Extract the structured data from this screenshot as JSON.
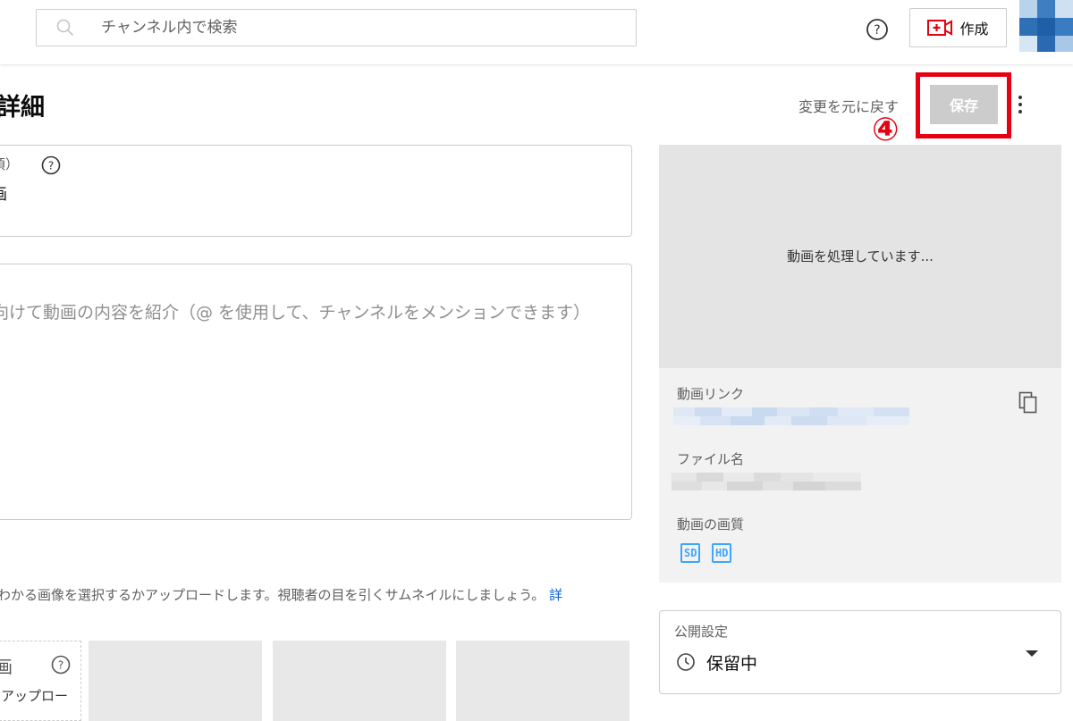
{
  "topbar": {
    "search": {
      "placeholder": "チャンネル内で検索",
      "value": ""
    },
    "create_label": "作成",
    "icons": {
      "search": "search-icon",
      "help": "help-icon",
      "create": "video-add-icon",
      "avatar": "pixel-avatar"
    }
  },
  "header": {
    "title": "詳細",
    "undo_label": "変更を元に戻す",
    "save_label": "保存",
    "annotation_number": "④",
    "more_icon": "more-vertical-icon"
  },
  "title_field": {
    "label": "須）",
    "value": "画"
  },
  "description_field": {
    "placeholder": "向けて動画の内容を紹介（@ を使用して、チャンネルをメンションできます）"
  },
  "thumbnail": {
    "description": "わかる画像を選択するかアップロードします。視聴者の目を引くサムネイルにしましょう。",
    "more_link": "詳",
    "upload_icon_glyph": "画",
    "upload_label": "アップロー"
  },
  "video_panel": {
    "processing_text": "動画を処理しています...",
    "link_label": "動画リンク",
    "filename_label": "ファイル名",
    "quality_label": "動画の画質",
    "quality_badges": [
      "SD",
      "HD"
    ]
  },
  "visibility": {
    "label": "公開設定",
    "value": "保留中",
    "icon": "clock-icon"
  },
  "colors": {
    "highlight_red": "#e60012",
    "link_blue": "#065fd4",
    "badge_blue": "#3ea6ff",
    "save_disabled_bg": "#cccccc"
  }
}
